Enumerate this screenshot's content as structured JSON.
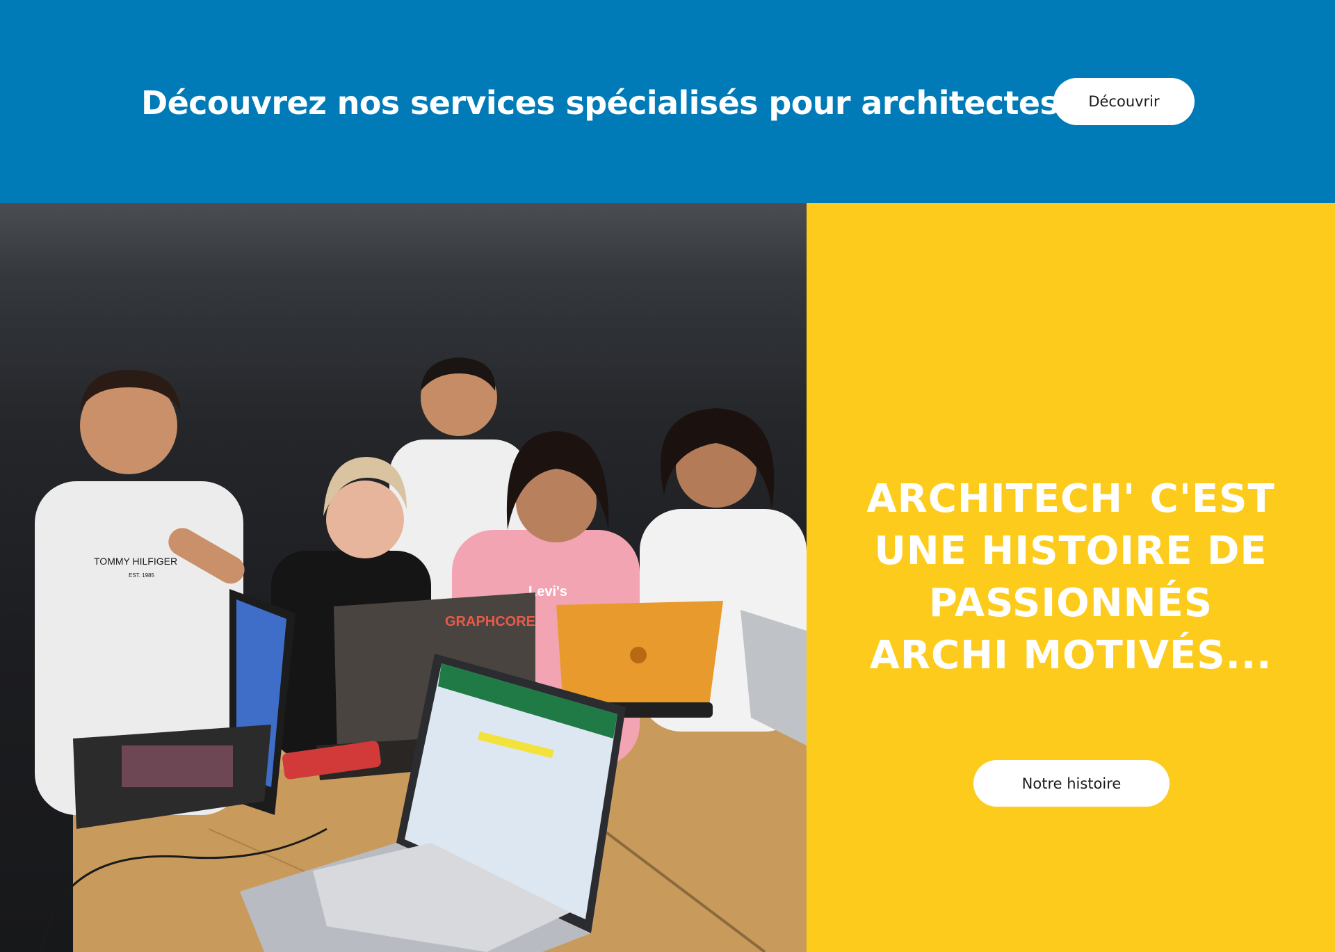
{
  "banner": {
    "heading": "Découvrez nos services spécialisés pour architectes",
    "button_label": "Découvrir",
    "background_color": "#007bb7"
  },
  "photo": {
    "laptop_brand_text": "GRAPHCORE",
    "tshirt_brand_text": "TOMMY HILFIGER",
    "tshirt_brand_subtext": "EST. 1985",
    "pink_shirt_text": "Levi's"
  },
  "promo": {
    "heading": "ARCHITECH' C'EST UNE HISTOIRE DE PASSIONNÉS ARCHI MOTIVÉS...",
    "button_label": "Notre histoire",
    "background_color": "#fdcb1b"
  }
}
